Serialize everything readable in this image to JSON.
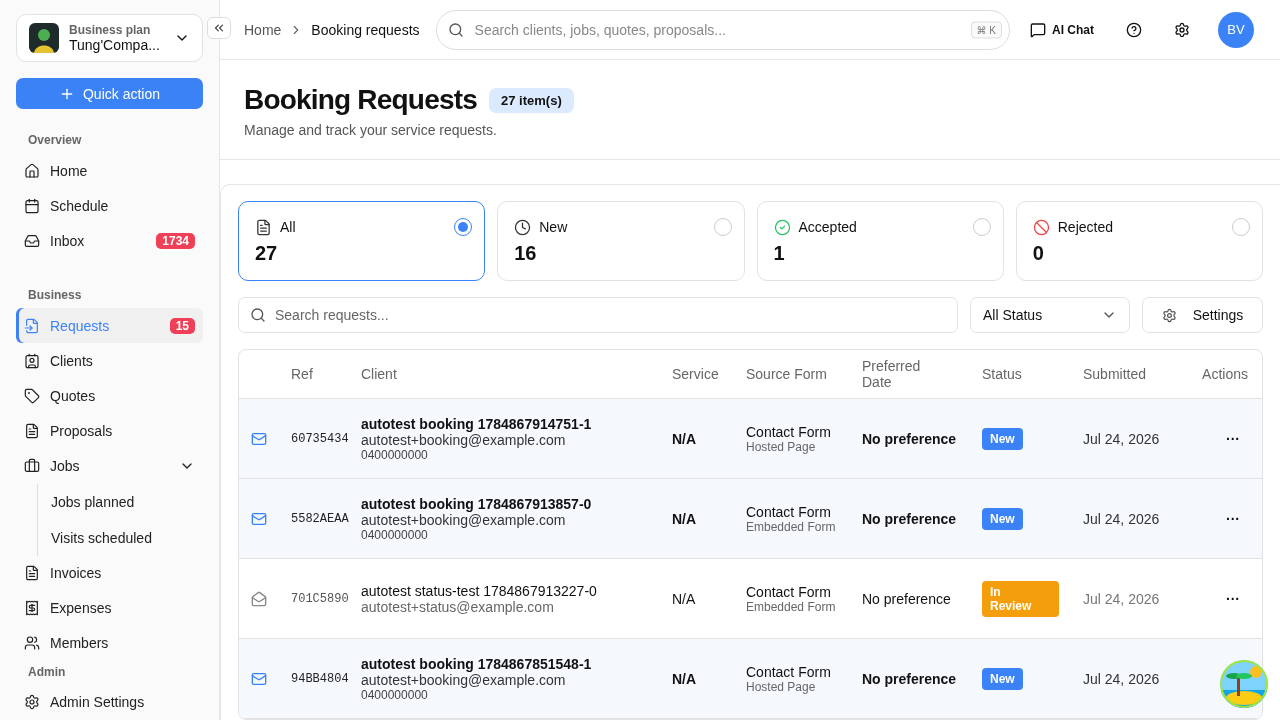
{
  "workspace": {
    "plan": "Business plan",
    "name": "Tung'Compa..."
  },
  "quick_action": "Quick action",
  "sidebar": {
    "sections": [
      {
        "title": "Overview",
        "items": [
          {
            "label": "Home",
            "selected": false
          },
          {
            "label": "Schedule",
            "selected": false
          },
          {
            "label": "Inbox",
            "selected": false,
            "badge": "1734"
          }
        ]
      },
      {
        "title": "Business",
        "items": [
          {
            "label": "Requests",
            "selected": true,
            "badge": "15"
          },
          {
            "label": "Clients",
            "selected": false
          },
          {
            "label": "Quotes",
            "selected": false
          },
          {
            "label": "Proposals",
            "selected": false
          },
          {
            "label": "Jobs",
            "selected": false,
            "expanded": true,
            "children": [
              {
                "label": "Jobs planned",
                "selected": false
              },
              {
                "label": "Visits scheduled",
                "selected": false
              }
            ]
          },
          {
            "label": "Invoices",
            "selected": false
          },
          {
            "label": "Expenses",
            "selected": false
          },
          {
            "label": "Members",
            "selected": false
          }
        ]
      }
    ],
    "admin": {
      "title": "Admin",
      "items": [
        {
          "label": "Admin Settings",
          "selected": false
        }
      ]
    }
  },
  "breadcrumb": [
    "Home",
    "Booking requests"
  ],
  "search": {
    "placeholder": "Search clients, jobs, quotes, proposals...",
    "shortcut": "⌘ K"
  },
  "topbar": {
    "ai_chat": "AI Chat",
    "avatar": "BV"
  },
  "page": {
    "title": "Booking Requests",
    "count": "27 item(s)",
    "subtitle": "Manage and track your service requests."
  },
  "filters": [
    {
      "label": "All",
      "count": "27",
      "selected": true
    },
    {
      "label": "New",
      "count": "16",
      "selected": false
    },
    {
      "label": "Accepted",
      "count": "1",
      "selected": false
    },
    {
      "label": "Rejected",
      "count": "0",
      "selected": false
    }
  ],
  "request_search": {
    "placeholder": "Search requests..."
  },
  "status_select": "All Status",
  "settings_button": "Settings",
  "table": {
    "columns": [
      "Ref",
      "Client",
      "Service",
      "Source Form",
      "Preferred Date",
      "Status",
      "Submitted",
      "Actions"
    ],
    "rows": [
      {
        "unread": true,
        "ref": "60735434",
        "client": "autotest booking 1784867914751-1",
        "email": "autotest+booking@example.com",
        "phone": "0400000000",
        "service": "N/A",
        "form": "Contact Form",
        "form_type": "Hosted Page",
        "date": "No preference",
        "status": "New",
        "kind": "new",
        "submitted": "Jul 24, 2026",
        "actions": "···"
      },
      {
        "unread": true,
        "ref": "5582AEAA",
        "client": "autotest booking 1784867913857-0",
        "email": "autotest+booking@example.com",
        "phone": "0400000000",
        "service": "N/A",
        "form": "Contact Form",
        "form_type": "Embedded Form",
        "date": "No preference",
        "status": "New",
        "kind": "new",
        "submitted": "Jul 24, 2026",
        "actions": "···"
      },
      {
        "unread": false,
        "ref": "701C5890",
        "client": "autotest status-test 1784867913227-0",
        "email": "autotest+status@example.com",
        "service": "N/A",
        "form": "Contact Form",
        "form_type": "Embedded Form",
        "date": "No preference",
        "status": "In Review",
        "kind": "review",
        "submitted": "Jul 24, 2026",
        "actions": "···"
      },
      {
        "unread": true,
        "ref": "94BB4804",
        "client": "autotest booking 1784867851548-1",
        "email": "autotest+booking@example.com",
        "phone": "0400000000",
        "service": "N/A",
        "form": "Contact Form",
        "form_type": "Hosted Page",
        "date": "No preference",
        "status": "New",
        "kind": "new",
        "submitted": "Jul 24, 2026"
      }
    ]
  }
}
